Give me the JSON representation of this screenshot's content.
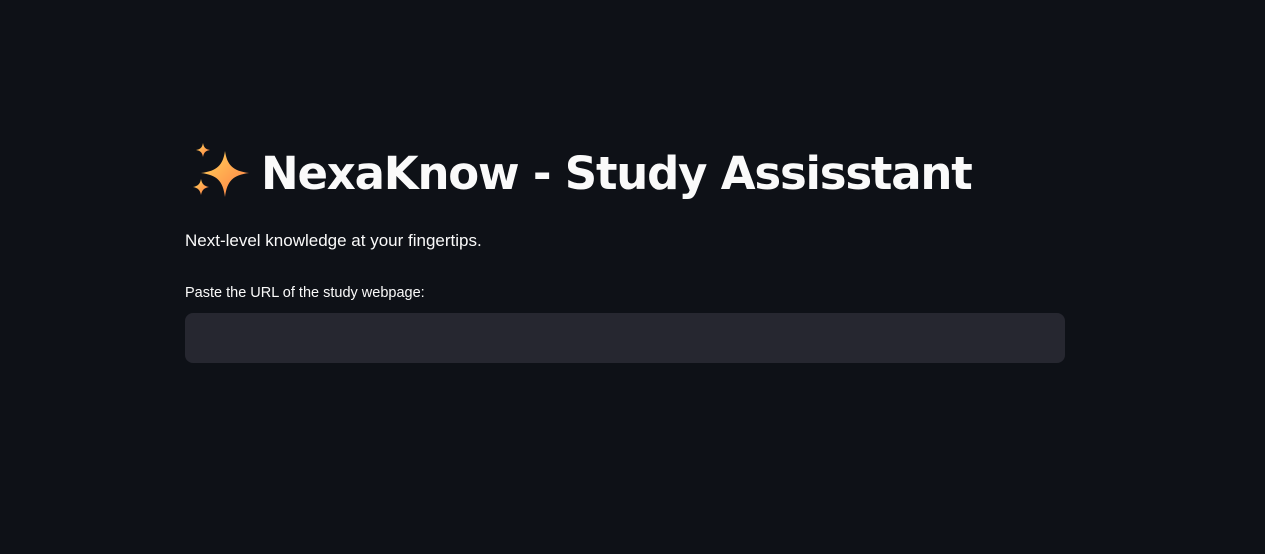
{
  "header": {
    "title_icon": "sparkles-icon",
    "title": "NexaKnow - Study Assisstant",
    "subtitle": "Next-level knowledge at your fingertips."
  },
  "url_field": {
    "label": "Paste the URL of the study webpage:",
    "value": "",
    "placeholder": ""
  },
  "colors": {
    "background": "#0e1117",
    "input_background": "#262730",
    "text": "#fafafa",
    "sparkle_gradient_start": "#ffcf4a",
    "sparkle_gradient_end": "#ff7a45"
  }
}
